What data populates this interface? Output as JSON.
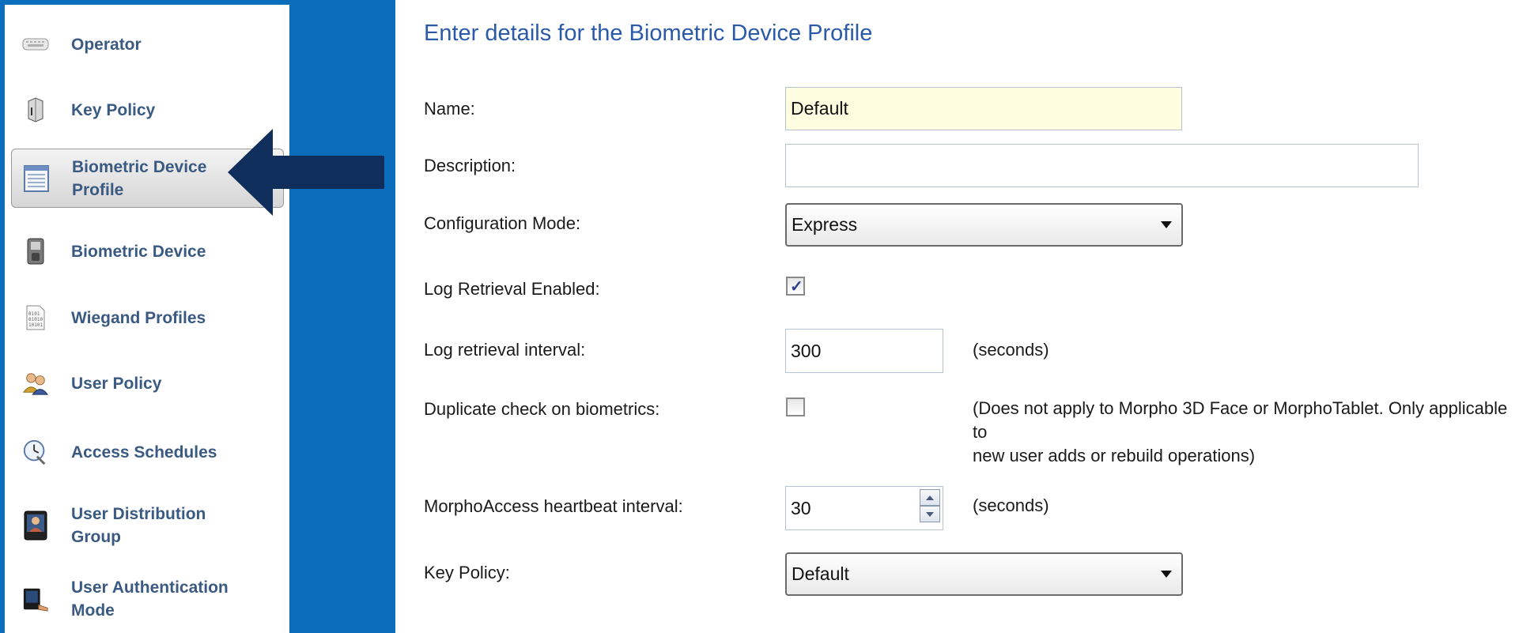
{
  "sidebar": {
    "items": [
      {
        "label": "Operator",
        "icon": "keyboard-icon"
      },
      {
        "label": "Key Policy",
        "icon": "key-cylinder-icon"
      },
      {
        "label": "Biometric Device\nProfile",
        "icon": "profile-document-icon",
        "selected": true
      },
      {
        "label": "Biometric Device",
        "icon": "biometric-terminal-icon"
      },
      {
        "label": "Wiegand Profiles",
        "icon": "binary-document-icon"
      },
      {
        "label": "User Policy",
        "icon": "users-icon"
      },
      {
        "label": "Access Schedules",
        "icon": "clock-icon"
      },
      {
        "label": "User Distribution\nGroup",
        "icon": "user-group-photo-icon"
      },
      {
        "label": "User Authentication\nMode",
        "icon": "authentication-device-icon"
      }
    ]
  },
  "form": {
    "title": "Enter details for the Biometric Device Profile",
    "name": {
      "label": "Name:",
      "value": "Default"
    },
    "description": {
      "label": "Description:",
      "value": ""
    },
    "configuration_mode": {
      "label": "Configuration Mode:",
      "value": "Express"
    },
    "log_retrieval_enabled": {
      "label": "Log Retrieval Enabled:",
      "checked": true
    },
    "log_retrieval_interval": {
      "label": "Log retrieval interval:",
      "value": "300",
      "unit": "(seconds)"
    },
    "duplicate_check": {
      "label": "Duplicate check on biometrics:",
      "checked": false,
      "note_line1": "(Does not apply to Morpho 3D Face or MorphoTablet. Only applicable to",
      "note_line2": "new user adds or rebuild operations)"
    },
    "heartbeat_interval": {
      "label": "MorphoAccess heartbeat interval:",
      "value": "30",
      "unit": "(seconds)"
    },
    "key_policy": {
      "label": "Key Policy:",
      "value": "Default"
    }
  },
  "colors": {
    "background": "#0a6ebd",
    "arrow": "#0f2e5c",
    "title": "#2a5aa8",
    "nav_label": "#3a5a82"
  }
}
